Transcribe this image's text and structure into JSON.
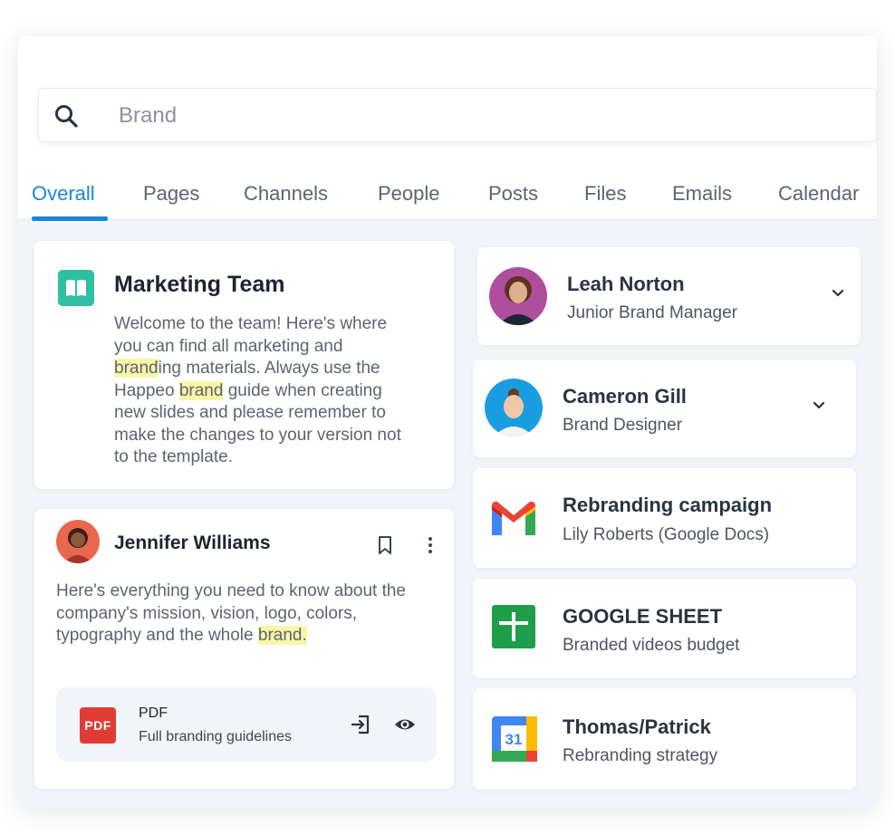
{
  "search": {
    "value": "",
    "placeholder": "Brand"
  },
  "tabs": [
    {
      "label": "Overall",
      "active": true
    },
    {
      "label": "Pages"
    },
    {
      "label": "Channels"
    },
    {
      "label": "People"
    },
    {
      "label": "Posts"
    },
    {
      "label": "Files"
    },
    {
      "label": "Emails"
    },
    {
      "label": "Calendar"
    }
  ],
  "marketing_team": {
    "icon": "book-icon",
    "title": "Marketing Team",
    "body": {
      "t1": "Welcome to the team! Here's where you can find all marketing and ",
      "h1": "brand",
      "t2": "ing materials. Always use the Happeo ",
      "h2": "brand",
      "t3": " guide when creating new slides and please remember to make the changes to your version not to the template."
    }
  },
  "post": {
    "author": "Jennifer Williams",
    "body": {
      "t1": "Here's everything you need to know about the company's mission, vision, logo, colors, typography and the whole ",
      "h1": "brand."
    },
    "attachment": {
      "icon_label": "PDF",
      "type": "PDF",
      "name": "Full branding guidelines"
    }
  },
  "results": [
    {
      "title": "Leah Norton",
      "subtitle": "Junior Brand Manager",
      "kind": "person"
    },
    {
      "title": "Cameron Gill",
      "subtitle": "Brand Designer",
      "kind": "person"
    },
    {
      "title": "Rebranding campaign",
      "subtitle": "Lily Roberts (Google Docs)",
      "icon": "gmail-icon"
    },
    {
      "title": "GOOGLE SHEET",
      "subtitle": "Branded videos budget",
      "icon": "google-sheets-icon"
    },
    {
      "title": "Thomas/Patrick",
      "subtitle": "Rebranding strategy",
      "icon": "google-calendar-icon",
      "calendar_day": "31"
    }
  ],
  "colors": {
    "accent": "#1a86d8",
    "highlight": "#fbf6a6",
    "panel_bg": "#f1f4f8",
    "teal": "#2fbfa2",
    "pdf_red": "#e03c36"
  }
}
